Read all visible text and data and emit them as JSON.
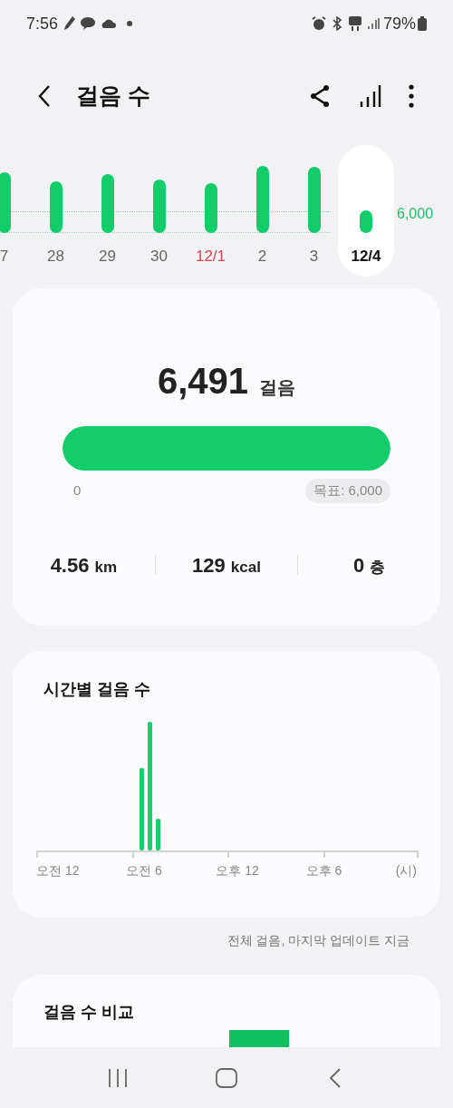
{
  "status_bar": {
    "time": "7:56",
    "battery": "79%"
  },
  "header": {
    "title": "걸음 수"
  },
  "days": [
    {
      "label": "7",
      "selected": false,
      "month_start": false
    },
    {
      "label": "28",
      "selected": false,
      "month_start": false
    },
    {
      "label": "29",
      "selected": false,
      "month_start": false
    },
    {
      "label": "30",
      "selected": false,
      "month_start": false
    },
    {
      "label": "12/1",
      "selected": false,
      "month_start": true
    },
    {
      "label": "2",
      "selected": false,
      "month_start": false
    },
    {
      "label": "3",
      "selected": false,
      "month_start": false
    },
    {
      "label": "12/4",
      "selected": true,
      "month_start": false
    }
  ],
  "goal_line_label": "6,000",
  "summary": {
    "steps": "6,491",
    "steps_unit": "걸음",
    "level": 1,
    "min_label": "0",
    "goal_label": "목표: 6,000",
    "stats": [
      {
        "value": "4.56",
        "unit": "km"
      },
      {
        "value": "129",
        "unit": "kcal"
      },
      {
        "value": "0",
        "unit": "층"
      }
    ]
  },
  "hourly": {
    "title": "시간별 걸음 수",
    "axis_labels": [
      "오전 12",
      "오전 6",
      "오후 12",
      "오후 6"
    ],
    "axis_unit": "(시)"
  },
  "update_note": "전체 걸음, 마지막 업데이트 지금",
  "compare": {
    "title": "걸음 수 비교"
  }
}
